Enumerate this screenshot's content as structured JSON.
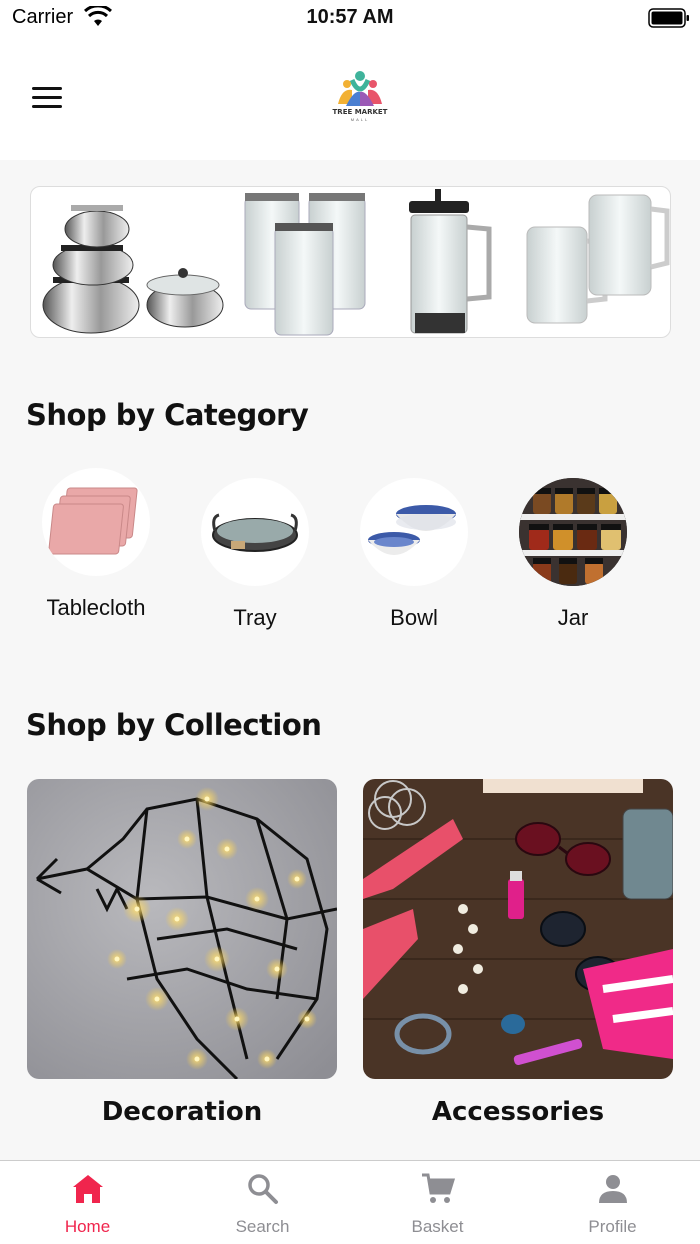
{
  "status_bar": {
    "carrier": "Carrier",
    "time": "10:57 AM"
  },
  "header": {
    "logo_text": "TREE MARKET",
    "logo_sub": "MALL"
  },
  "sections": {
    "category_title": "Shop by Category",
    "collection_title": "Shop by Collection"
  },
  "categories": [
    {
      "label": "Tablecloth"
    },
    {
      "label": "Tray"
    },
    {
      "label": "Bowl"
    },
    {
      "label": "Jar"
    }
  ],
  "collections": [
    {
      "label": "Decoration"
    },
    {
      "label": "Accessories"
    }
  ],
  "tabbar": {
    "items": [
      {
        "label": "Home",
        "icon": "home-icon",
        "active": true
      },
      {
        "label": "Search",
        "icon": "search-icon",
        "active": false
      },
      {
        "label": "Basket",
        "icon": "cart-icon",
        "active": false
      },
      {
        "label": "Profile",
        "icon": "person-icon",
        "active": false
      }
    ]
  },
  "colors": {
    "accent": "#f0254d",
    "inactive": "#8e8e93",
    "background": "#f7f7f7"
  }
}
